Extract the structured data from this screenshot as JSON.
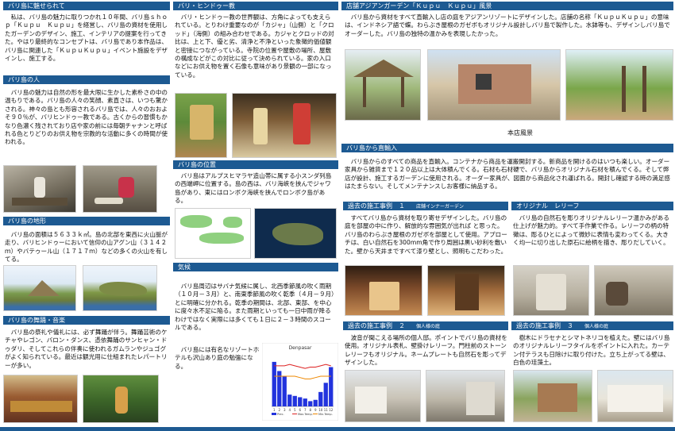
{
  "col1": {
    "h1": "バリ島に魅せられて",
    "p1": "　私は、バリ島の魅力に取りつかれ１０年間、バリ島ｓｈｏｐ「Ｋｕｐｕ　Ｋｕｐｕ」を経営し、バリ島の資材を使用したガーデンのデザイン、施工、インテリアの提案を行ってきた。やはり最終的なコンセプトは、バリ島であり本作品は、バリ島に関連した「ＫｕｐｕＫｕｐｕ」イベント施設をデザインし、施工する。",
    "h2": "バリ島の人",
    "p2": "　バリ島の魅力は自然の形を最大限に生かした素朴さの中の温もりである。バリ島の人々の笑顔、素直さは、いつも驚かされる。神々の島とも形容されるバリ島では、人々のおおよそ９０％が、バリヒンドゥー教である。古くからの習慣もかなり色濃く残されており店や家の前には毎朝チャナンと呼ばれる色とりどりのお供え物を宗教的な活動に多くの時間が使われる。",
    "h3": "バリ島の地形",
    "p3": "　バリ島の面積は５６３３ｋ㎡。島の北部を東西に火山脈が走り、バリヒンドゥーにおいて信仰の山アグン山（３１４２ｍ）やバテゥール山（１７１７ｍ）などの多くの火山を有してる。",
    "h4": "バリ島の舞踊・音楽",
    "p4": "　バリ島の祭礼や儀礼には、必ず舞踊が伴う。舞踊芸術のケチャやレゴン、バロン・ダンス、憑依舞踊のサンヒャン・ドゥダリ、そしてこれらの伴奏に使われるガムランやジュゴグがよく知られている。最近は観光用に仕組まれたレパートリーが多い。"
  },
  "col2": {
    "h1": "バリ・ヒンドゥー教",
    "p1": "　バリ・ヒンドゥー教の世界観は、方角によっても支えられている。とりわけ重要なのが「カジャ」（山側）と「クロッド」（海側）の組み合わせである。カジャとクロッドの対比は、上と下、優と劣、清浄と不浄といった象徴的価値観と密接につながっている。寺院の位置や屋敷の場所、屋敷の構成などがこの対比に従って決められている。家の入口などにお供え物を置く石像も意味があり景観の一部になっている。",
    "h2": "バリ島の位置",
    "p2": "　バリ島はアルプスヒマラヤ造山帯に属する小スンダ列島の西端岬に位置する。島の西は、バリ海峡を挟んでジャワ島があり、東にはロンボク海峡を挟んでロンボク島がある。",
    "h3": "気候",
    "p3": "　バリ島周辺はサバナ気候に属し、北西季節風の吹く雨期（１０月－３月）と、南東季節風の吹く乾季（４月－９月）とに明確に分かれる。乾季の期間は、北部、東部、を中心に度々水不足に陥る。また雨期といっても一日中雨が降るわけではなく実際には多くても１日に２－３時間のスコールである。",
    "p4": "　バリ島には有名なリゾートホテルも沢山あり庭の勉強になる。"
  },
  "col3": {
    "h1": "店舗アジアンガーデン「Ｋｕｐｕ　Ｋｕｐｕ」風景",
    "p1": "　バリ島から資材をすべて直輸入し店の庭をアジアンリゾートにデザインした。店舗の名称「ＫｕｐｕＫｕｐｕ」の意味は、インドネシア語で蝶。わらぶき屋根のガゼボもオリジナル設計しバリ島で製作した。水鉢等も、デザインしバリ島でオーダーした。バリ島の独特の温かみを表現したかった。",
    "caption": "本店風景",
    "h2": "バリ島から直輸入",
    "p2": "　バリ島からのすべての商品を直輸入。コンテナから商品を運搬開封する。新商品を開けるのはいつも楽しい。オーダー家具から雑貨まで１２０品以上は大体積んでくる。石材も石材硬で、バリ島からオリジナル石材を積んでくる。そして弊店が設計、施工するガーデンに使用される。オーダー家具が、図面から商品化され運ばれる。開封し確認する時の満足感はたまらない。そしてメンテナンスしお客様に納品する。",
    "h3": "過去の施工事例　１",
    "h3sub": "店舗インナーガーデン",
    "p3": "　すべてバリ島から資材を取り寄せデザインした。バリ島の庭を部屋の中に作り、解放的な雰囲気が出れば と思った。バリ島のわらぶき屋根のガゼボを部屋として使用。アプローチは、白い自然石を300mm角で作り周囲は黒い砂利を敷いた。壁から天井まですべて漆り壁とし、照明もこだわった。",
    "h4": "オリジナル　レリーフ",
    "p4": "　バリ島の自然石を彫りオリジナルレリーフ温かみがある仕上げが魅力的。すべて手作業で作る。レリーフの柄の特徴は、彫るひとによって微妙に表情も変わってくる。大きく均一に切り出した原石に絵柄を描き、彫りだしていく。",
    "h5": "過去の施工事例　２",
    "h5sub": "個人様の庭",
    "p5": "　波音が聞こえる場所の個人邸。ポイントでバリ島の資材を使用。オリジナル表札、壁掛けレリーフ。門柱前のストーンレリーフもオリジナル。ネームプレートも自然石を彫ってデザインした。",
    "h6": "過去の施工事例　３",
    "h6sub": "個人様の庭",
    "p6": "　樹木にドラセナとシマトネリコを植えた。壁にはバリ島のオリジナルレリーフタイルをポイントに入れた。カーテン付テラスも日除けに取り付けた。立ち上がってる壁は、白色の珪藻土。"
  },
  "colors": {
    "header": "#1d5a92",
    "bar": "#2233dd",
    "line": "#dd2222"
  },
  "chart_data": {
    "type": "bar",
    "title": "Denpasar",
    "categories": [
      "1",
      "2",
      "3",
      "4",
      "5",
      "6",
      "7",
      "8",
      "9",
      "10",
      "11",
      "12"
    ],
    "series": [
      {
        "name": "Prec.",
        "values": [
          340,
          270,
          230,
          90,
          80,
          70,
          60,
          40,
          50,
          110,
          180,
          300
        ]
      },
      {
        "name": "Max.Temp.",
        "values": [
          31,
          31,
          31,
          32,
          31,
          30,
          29,
          30,
          30,
          31,
          32,
          31
        ]
      },
      {
        "name": "Min.Temp.",
        "values": [
          23,
          23,
          23,
          23,
          23,
          22,
          21,
          21,
          22,
          23,
          23,
          23
        ]
      }
    ],
    "ylim": [
      0,
      400
    ]
  }
}
